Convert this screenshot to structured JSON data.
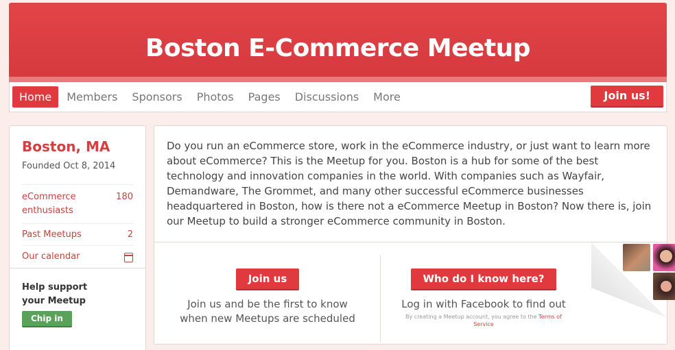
{
  "header": {
    "title": "Boston E-Commerce Meetup"
  },
  "nav": {
    "items": [
      {
        "label": "Home",
        "active": true
      },
      {
        "label": "Members"
      },
      {
        "label": "Sponsors"
      },
      {
        "label": "Photos"
      },
      {
        "label": "Pages"
      },
      {
        "label": "Discussions"
      },
      {
        "label": "More"
      }
    ],
    "join_label": "Join us!"
  },
  "sidebar": {
    "city": "Boston, MA",
    "founded": "Founded Oct 8, 2014",
    "rows": [
      {
        "label": "eCommerce enthusiasts",
        "count": "180"
      },
      {
        "label": "Past Meetups",
        "count": "2"
      },
      {
        "label": "Our calendar"
      }
    ],
    "support_text": "Help support your Meetup",
    "chip_label": "Chip in"
  },
  "main": {
    "description": "Do you run an eCommerce store, work in the eCommerce industry, or just want to learn more about eCommerce? This is the Meetup for you. Boston is a hub for some of the best technology and innovation companies in the world. With companies such as Wayfair, Demandware, The Grommet, and many other successful eCommerce businesses headquartered in Boston, how is there not a eCommerce Meetup in Boston? Now there is, join our Meetup to build a stronger eCommerce community in Boston.",
    "join_button": "Join us",
    "join_text": "Join us and be the first to know when new Meetups are scheduled",
    "who_button": "Who do I know here?",
    "who_text": "Log in with Facebook to find out",
    "tos_text": "By creating a Meetup account, you agree to the",
    "tos_link": "Terms of Service"
  }
}
